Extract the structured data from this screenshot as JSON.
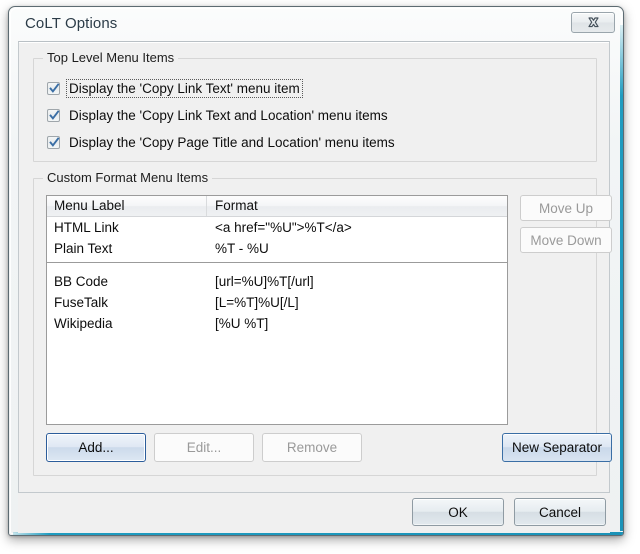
{
  "window": {
    "title": "CoLT Options",
    "close_icon": "close-icon",
    "accent_color": "#1f9cc0"
  },
  "top_level_group": {
    "label": "Top Level Menu Items",
    "checkboxes": [
      {
        "label": "Display the 'Copy Link Text' menu item",
        "checked": true,
        "focused": true
      },
      {
        "label": "Display the 'Copy Link Text and Location' menu items",
        "checked": true,
        "focused": false
      },
      {
        "label": "Display the 'Copy Page Title and Location' menu items",
        "checked": true,
        "focused": false
      }
    ]
  },
  "custom_format_group": {
    "label": "Custom Format Menu Items",
    "columns": [
      "Menu Label",
      "Format"
    ],
    "rows": [
      {
        "type": "item",
        "menu_label": "HTML Link",
        "format": "<a href=\"%U\">%T</a>"
      },
      {
        "type": "item",
        "menu_label": "Plain Text",
        "format": "%T - %U"
      },
      {
        "type": "separator"
      },
      {
        "type": "item",
        "menu_label": "BB Code",
        "format": "[url=%U]%T[/url]"
      },
      {
        "type": "item",
        "menu_label": "FuseTalk",
        "format": "[L=%T]%U[/L]"
      },
      {
        "type": "item",
        "menu_label": "Wikipedia",
        "format": "[%U %T]"
      }
    ],
    "side_buttons": [
      {
        "label": "Move Up",
        "enabled": false
      },
      {
        "label": "Move Down",
        "enabled": false
      }
    ],
    "action_buttons": [
      {
        "label": "Add...",
        "enabled": true,
        "state": "default"
      },
      {
        "label": "Edit...",
        "enabled": false,
        "state": "disabled"
      },
      {
        "label": "Remove",
        "enabled": false,
        "state": "disabled"
      }
    ],
    "new_separator_button": {
      "label": "New Separator",
      "enabled": true,
      "state": "hot"
    }
  },
  "dialog_buttons": [
    {
      "label": "OK",
      "enabled": true
    },
    {
      "label": "Cancel",
      "enabled": true
    }
  ]
}
